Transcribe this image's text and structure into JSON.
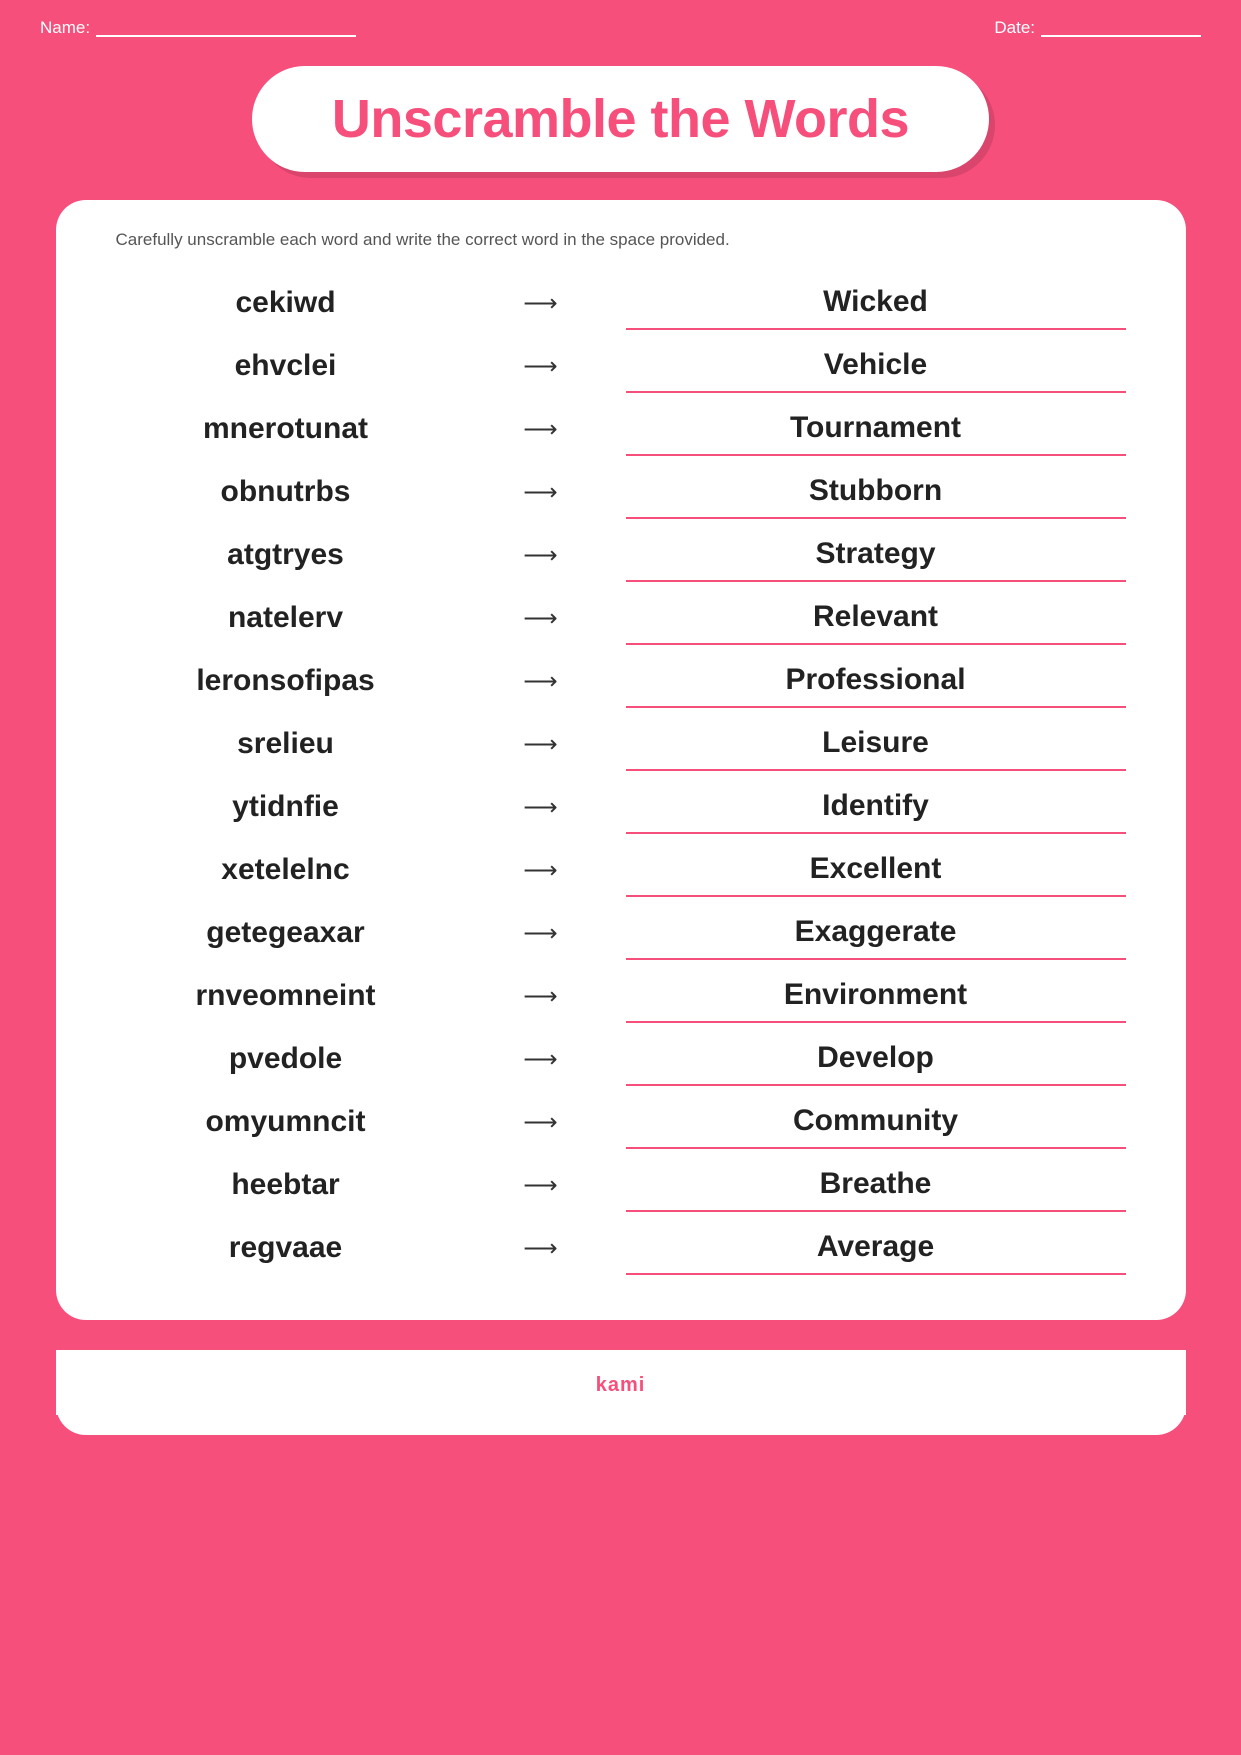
{
  "header": {
    "name_label": "Name:",
    "date_label": "Date:"
  },
  "title": "Unscramble the Words",
  "instructions": "Carefully unscramble each word and write the correct word in the space provided.",
  "words": [
    {
      "scrambled": "cekiwd",
      "answer": "Wicked"
    },
    {
      "scrambled": "ehvclei",
      "answer": "Vehicle"
    },
    {
      "scrambled": "mnerotunat",
      "answer": "Tournament"
    },
    {
      "scrambled": "obnutrbs",
      "answer": "Stubborn"
    },
    {
      "scrambled": "atgtryes",
      "answer": "Strategy"
    },
    {
      "scrambled": "natelerv",
      "answer": "Relevant"
    },
    {
      "scrambled": "leronsofipas",
      "answer": "Professional"
    },
    {
      "scrambled": "srelieu",
      "answer": "Leisure"
    },
    {
      "scrambled": "ytidnfie",
      "answer": "Identify"
    },
    {
      "scrambled": "xetelelnc",
      "answer": "Excellent"
    },
    {
      "scrambled": "getegeaxar",
      "answer": "Exaggerate"
    },
    {
      "scrambled": "rnveomneint",
      "answer": "Environment"
    },
    {
      "scrambled": "pvedole",
      "answer": "Develop"
    },
    {
      "scrambled": "omyumncit",
      "answer": "Community"
    },
    {
      "scrambled": "heebtar",
      "answer": "Breathe"
    },
    {
      "scrambled": "regvaae",
      "answer": "Average"
    }
  ],
  "footer": "kami",
  "arrow": "⟶",
  "colors": {
    "primary": "#f74f7b",
    "white": "#ffffff",
    "text_dark": "#222222",
    "text_muted": "#555555"
  }
}
